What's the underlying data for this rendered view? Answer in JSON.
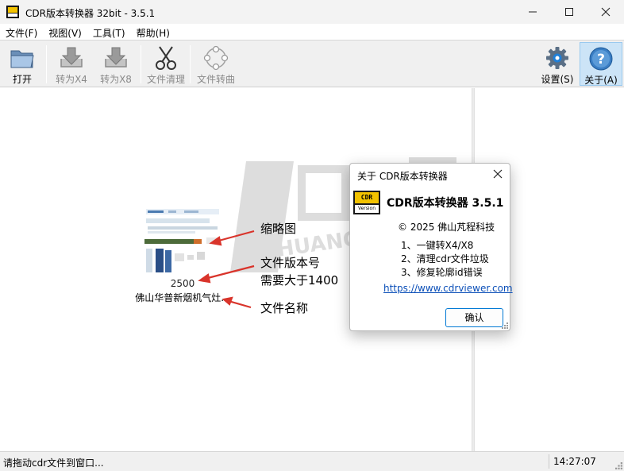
{
  "window": {
    "title": "CDR版本转换器 32bit - 3.5.1"
  },
  "menu": {
    "items": [
      "文件(F)",
      "视图(V)",
      "工具(T)",
      "帮助(H)"
    ]
  },
  "toolbar": {
    "open_label": "打开",
    "to_x4_label": "转为X4",
    "to_x8_label": "转为X8",
    "clean_label": "文件清理",
    "curve_label": "文件转曲",
    "settings_label": "设置(S)",
    "about_label": "关于(A)"
  },
  "main": {
    "version_number": "2500",
    "file_name": "佛山华普新烟机气灶...",
    "annotations": {
      "thumbnail": "缩略图",
      "version_line1": "文件版本号",
      "version_line2": "需要大于1400",
      "file_name": "文件名称"
    },
    "watermark": "HUANGSHU"
  },
  "about_dialog": {
    "title": "关于 CDR版本转换器",
    "logo_top": "CDR",
    "logo_bottom": "Version",
    "app_name": "CDR版本转换器 3.5.1",
    "copyright": "© 2025 佛山芃程科技",
    "features": [
      "1、一键转X4/X8",
      "2、清理cdr文件垃圾",
      "3、修复轮廓id错误"
    ],
    "link": "https://www.cdrviewer.com",
    "ok_label": "确认"
  },
  "status": {
    "message": "请拖动cdr文件到窗口...",
    "time": "14:27:07"
  },
  "colors": {
    "accent": "#0078d4",
    "link": "#0b4fb8",
    "annotation_arrow": "#d9342b",
    "active_button_bg": "#cce4f7"
  }
}
